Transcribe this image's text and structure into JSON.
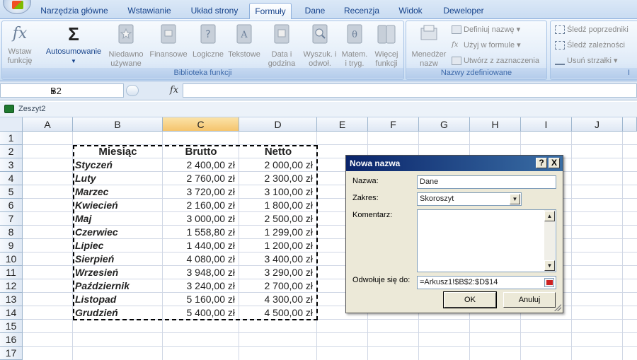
{
  "ribbon_tabs": [
    "Narzędzia główne",
    "Wstawianie",
    "Układ strony",
    "Formuły",
    "Dane",
    "Recenzja",
    "Widok",
    "Deweloper"
  ],
  "active_tab": "Formuły",
  "groups": {
    "function_library": {
      "label": "Biblioteka funkcji",
      "buttons": {
        "insert_function": [
          "Wstaw",
          "funkcję"
        ],
        "autosum": "Autosumowanie",
        "recent": [
          "Niedawno",
          "używane"
        ],
        "financial": "Finansowe",
        "logical": "Logiczne",
        "text": "Tekstowe",
        "datetime": [
          "Data i",
          "godzina"
        ],
        "lookup": [
          "Wyszuk. i",
          "odwoł."
        ],
        "math": [
          "Matem.",
          "i tryg."
        ],
        "more": [
          "Więcej",
          "funkcji"
        ]
      }
    },
    "defined_names": {
      "label": "Nazwy zdefiniowane",
      "manager": [
        "Menedżer",
        "nazw"
      ],
      "define_name": "Definiuj nazwę",
      "use_in_formula": "Użyj w formule",
      "create_from_selection": "Utwórz z zaznaczenia"
    },
    "formula_auditing": {
      "trace_precedents": "Śledź poprzedniki",
      "trace_dependents": "Śledź zależności",
      "remove_arrows": "Usuń strzałki"
    }
  },
  "formula_bar": {
    "name_box": "B2",
    "fx_label": "fx",
    "formula": ""
  },
  "workbook_title": "Zeszyt2",
  "columns": [
    "A",
    "B",
    "C",
    "D",
    "E",
    "F",
    "G",
    "H",
    "I",
    "J"
  ],
  "selected_column": "C",
  "rows": [
    "1",
    "2",
    "3",
    "4",
    "5",
    "6",
    "7",
    "8",
    "9",
    "10",
    "11",
    "12",
    "13",
    "14",
    "15",
    "16",
    "17"
  ],
  "table": {
    "headers": [
      "Miesiąc",
      "Brutto",
      "Netto"
    ],
    "data": [
      [
        "Styczeń",
        "2 400,00 zł",
        "2 000,00 zł"
      ],
      [
        "Luty",
        "2 760,00 zł",
        "2 300,00 zł"
      ],
      [
        "Marzec",
        "3 720,00 zł",
        "3 100,00 zł"
      ],
      [
        "Kwiecień",
        "2 160,00 zł",
        "1 800,00 zł"
      ],
      [
        "Maj",
        "3 000,00 zł",
        "2 500,00 zł"
      ],
      [
        "Czerwiec",
        "1 558,80 zł",
        "1 299,00 zł"
      ],
      [
        "Lipiec",
        "1 440,00 zł",
        "1 200,00 zł"
      ],
      [
        "Sierpień",
        "4 080,00 zł",
        "3 400,00 zł"
      ],
      [
        "Wrzesień",
        "3 948,00 zł",
        "3 290,00 zł"
      ],
      [
        "Październik",
        "3 240,00 zł",
        "2 700,00 zł"
      ],
      [
        "Listopad",
        "5 160,00 zł",
        "4 300,00 zł"
      ],
      [
        "Grudzień",
        "5 400,00 zł",
        "4 500,00 zł"
      ]
    ]
  },
  "dialog": {
    "title": "Nowa nazwa",
    "help": "?",
    "close": "X",
    "name_label": "Nazwa:",
    "name_value": "Dane",
    "scope_label": "Zakres:",
    "scope_value": "Skoroszyt",
    "comment_label": "Komentarz:",
    "comment_value": "",
    "refers_label": "Odwołuje się do:",
    "refers_value": "=Arkusz1!$B$2:$D$14",
    "ok": "OK",
    "cancel": "Anuluj"
  }
}
